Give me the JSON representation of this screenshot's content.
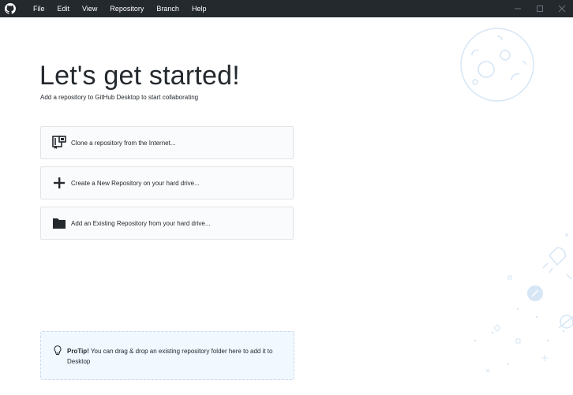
{
  "menu": {
    "items": [
      "File",
      "Edit",
      "View",
      "Repository",
      "Branch",
      "Help"
    ]
  },
  "welcome": {
    "title": "Let's get started!",
    "subtitle": "Add a repository to GitHub Desktop to start collaborating"
  },
  "actions": [
    {
      "label": "Clone a repository from the Internet...",
      "icon": "clone-repo-icon"
    },
    {
      "label": "Create a New Repository on your hard drive...",
      "icon": "plus-icon"
    },
    {
      "label": "Add an Existing Repository from your hard drive...",
      "icon": "folder-icon"
    }
  ],
  "protip": {
    "bold": "ProTip!",
    "text": " You can drag & drop an existing repository folder here to add it to Desktop",
    "icon": "lightbulb-icon"
  },
  "colors": {
    "titlebar": "#24292e",
    "card_bg": "#fafbfc",
    "card_border": "#e1e4e8",
    "protip_bg": "#f1f8ff",
    "protip_border": "#c8d9ee",
    "decor": "#d6e6f5"
  }
}
